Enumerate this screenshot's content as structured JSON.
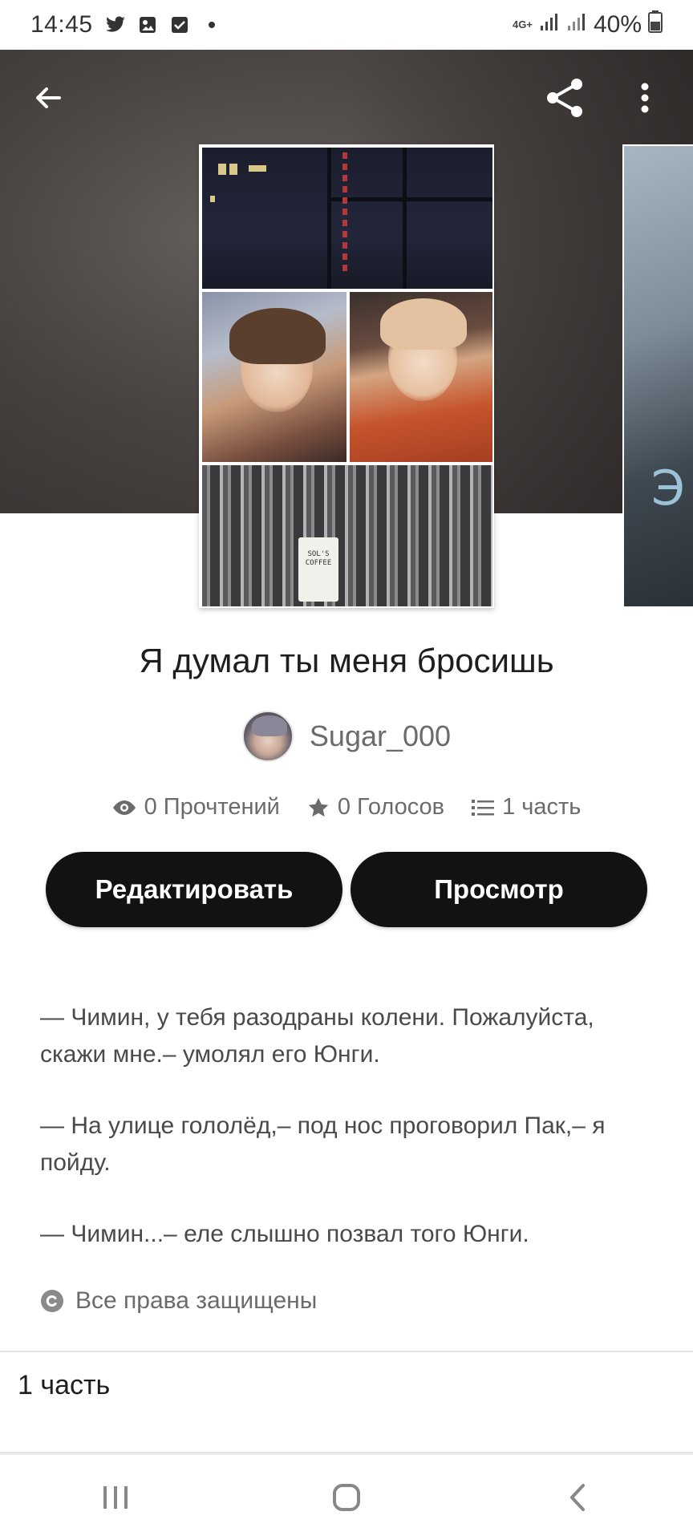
{
  "status_bar": {
    "time": "14:45",
    "battery": "40%",
    "network_top": "4G+",
    "icons": [
      "twitter-icon",
      "gallery-icon",
      "checkbox-icon",
      "dot-icon"
    ]
  },
  "header": {
    "back_icon": "arrow-left-icon",
    "share_icon": "share-icon",
    "menu_icon": "more-vertical-icon"
  },
  "cover": {
    "sign_text": "SOL'S COFFEE",
    "next_letter": "Э"
  },
  "story": {
    "title": "Я думал ты меня бросишь",
    "author": "Sugar_000",
    "stats": {
      "reads": "0 Прочтений",
      "votes": "0 Голосов",
      "parts": "1 часть"
    },
    "edit_label": "Редактировать",
    "preview_label": "Просмотр",
    "description": [
      "— Чимин, у тебя разодраны колени. Пожалуйста, скажи мне.– умолял его Юнги.",
      "— На улице гололёд,– под нос проговорил Пак,– я пойду.",
      "— Чимин...– еле слышно позвал того Юнги."
    ],
    "copyright": "Все права защищены",
    "parts_header": "1 часть"
  },
  "colors": {
    "button_bg": "#121212",
    "text_muted": "#6b6b6b"
  }
}
